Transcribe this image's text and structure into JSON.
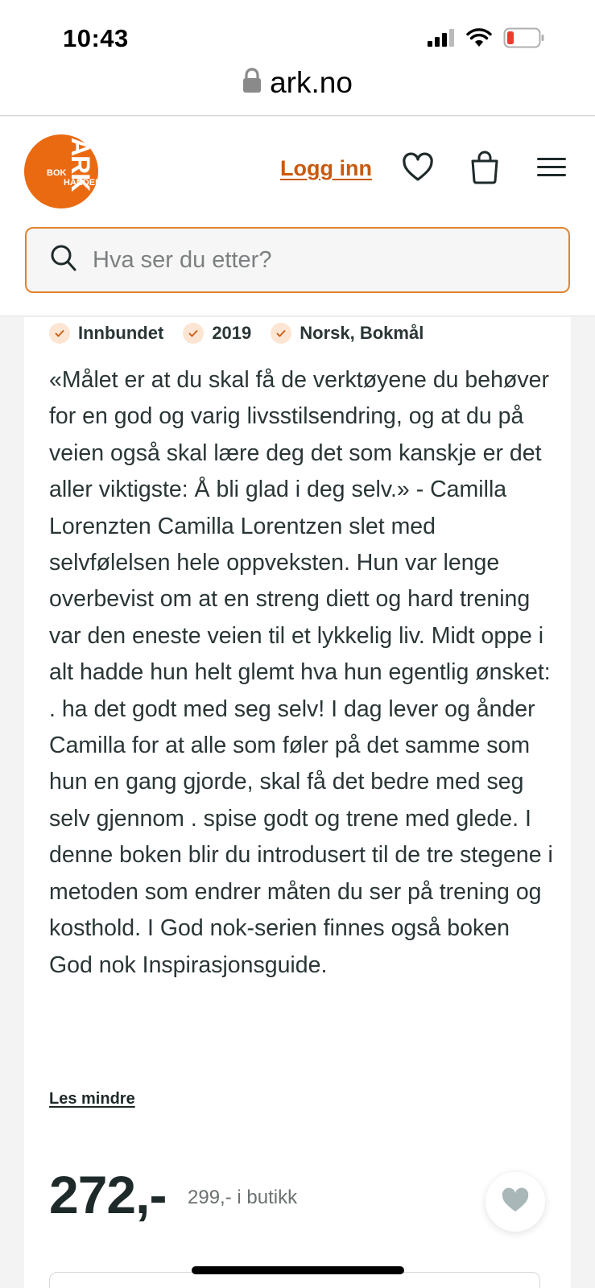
{
  "status_bar": {
    "time": "10:43"
  },
  "browser": {
    "url": "ark.no"
  },
  "header": {
    "logo_text": [
      "ARK",
      "BOK",
      "HANDEL"
    ],
    "login_label": "Logg inn",
    "search_placeholder": "Hva ser du etter?"
  },
  "product": {
    "tags": [
      "Innbundet",
      "2019",
      "Norsk, Bokmål"
    ],
    "description": "«Målet er at du skal få de verktøyene du behøver for en god og varig livsstilsendring, og at du på veien også skal lære deg det som kanskje er det aller viktigste: Å bli glad i deg selv.» - Camilla Lorenzten Camilla Lorentzen slet med selvfølelsen hele oppveksten. Hun var lenge overbevist om at en streng diett og hard trening var den eneste veien til et lykkelig liv. Midt oppe i alt hadde hun helt glemt hva hun egentlig ønsket: . ha det godt med seg selv! I dag lever og ånder Camilla for at alle som føler på det samme som hun en gang gjorde, skal få det bedre med seg selv gjennom . spise godt og trene med glede. I denne boken blir du introdusert til de tre stegene i metoden som endrer måten du ser på trening og kosthold. I God nok-serien finnes også boken God nok Inspirasjonsguide.",
    "read_less_label": "Les mindre",
    "price": "272,-",
    "store_price": "299,- i butikk"
  },
  "colors": {
    "brand": "#ea6a12",
    "link": "#c85a10"
  }
}
